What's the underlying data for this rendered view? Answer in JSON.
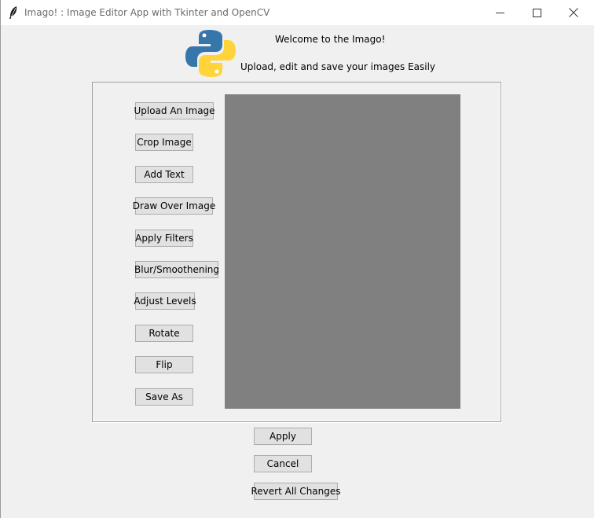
{
  "window": {
    "title": "Imago! : Image Editor App with Tkinter and OpenCV",
    "controls": [
      "minimize-icon",
      "maximize-icon",
      "close-icon"
    ]
  },
  "header": {
    "logo_icon": "python-logo-icon",
    "welcome": "Welcome to the Imago!",
    "tagline": "Upload, edit and save your images Easily"
  },
  "sidebar": {
    "buttons": [
      {
        "label": "Upload An Image"
      },
      {
        "label": "Crop Image"
      },
      {
        "label": "Add Text"
      },
      {
        "label": "Draw Over Image"
      },
      {
        "label": "Apply Filters"
      },
      {
        "label": "Blur/Smoothening"
      },
      {
        "label": "Adjust Levels"
      },
      {
        "label": "Rotate"
      },
      {
        "label": "Flip"
      },
      {
        "label": "Save As"
      }
    ]
  },
  "canvas": {
    "background": "#808080"
  },
  "footer": {
    "apply_label": "Apply",
    "cancel_label": "Cancel",
    "revert_label": "Revert All Changes"
  }
}
